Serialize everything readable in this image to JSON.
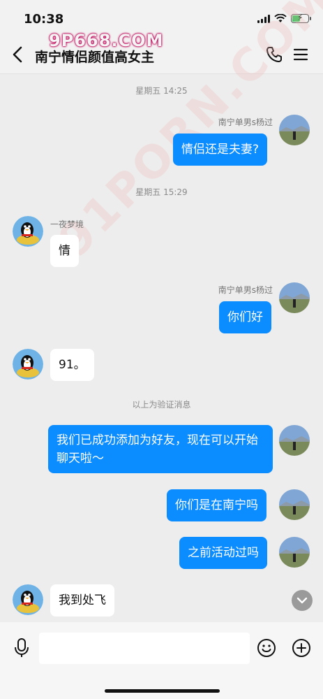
{
  "status_bar": {
    "time": "10:38"
  },
  "header": {
    "title": "南宁情侣颜值高女主",
    "back_icon": "chevron-left-icon",
    "call_icon": "phone-icon",
    "menu_icon": "hamburger-menu-icon"
  },
  "watermark": {
    "top": "9P668.COM",
    "diagonal": "91PORN.COM"
  },
  "messages": [
    {
      "type": "timestamp",
      "text": "星期五 14:25"
    },
    {
      "type": "outgoing",
      "sender": "南宁单男s杨过",
      "text": "情侣还是夫妻?"
    },
    {
      "type": "timestamp",
      "text": "星期五 15:29"
    },
    {
      "type": "incoming",
      "sender": "一夜梦境",
      "text": "情"
    },
    {
      "type": "outgoing",
      "sender": "南宁单男s杨过",
      "text": "你们好"
    },
    {
      "type": "incoming",
      "text": "91。"
    },
    {
      "type": "system",
      "text": "以上为验证消息"
    },
    {
      "type": "outgoing",
      "text": "我们已成功添加为好友，现在可以开始聊天啦～"
    },
    {
      "type": "outgoing",
      "text": "你们是在南宁吗"
    },
    {
      "type": "outgoing",
      "text": "之前活动过吗"
    },
    {
      "type": "incoming",
      "text": "我到处飞"
    }
  ],
  "input_bar": {
    "placeholder": "",
    "mic_icon": "microphone-icon",
    "emoji_icon": "smiley-icon",
    "plus_icon": "plus-circle-icon"
  },
  "colors": {
    "outgoing_bubble": "#0b8cff",
    "incoming_bubble": "#ffffff",
    "background": "#ededed",
    "watermark_accent": "#b3004f"
  }
}
